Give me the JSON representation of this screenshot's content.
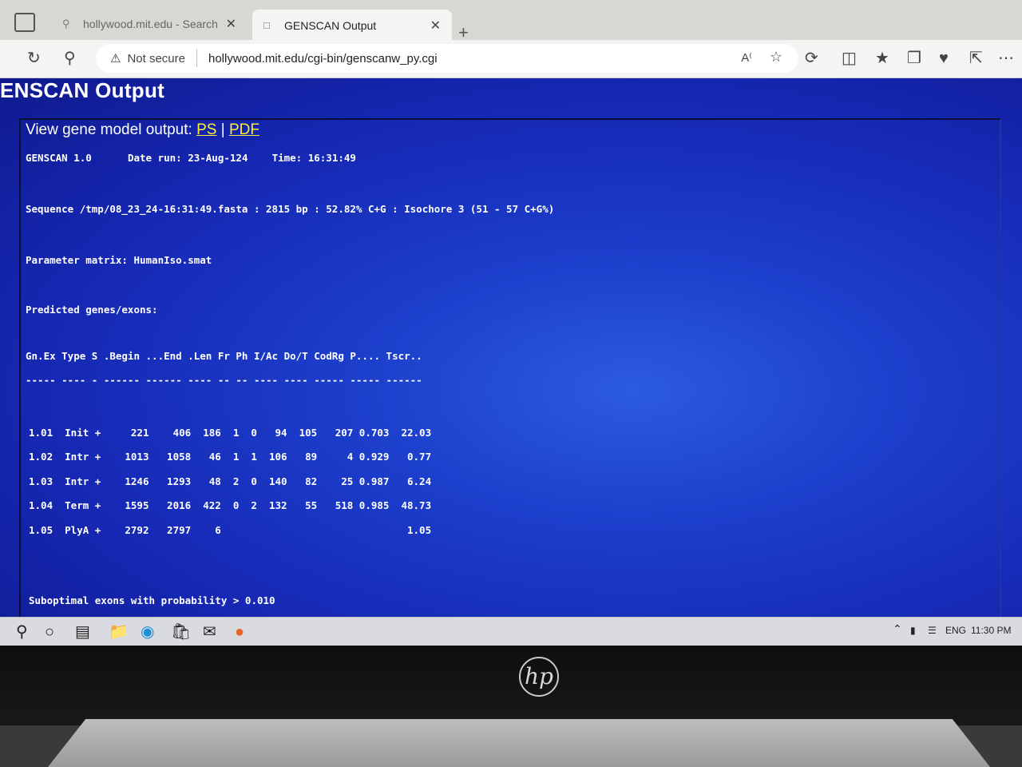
{
  "browser": {
    "tabs": [
      {
        "label": "hollywood.mit.edu - Search",
        "active": false
      },
      {
        "label": "GENSCAN Output",
        "active": true
      }
    ],
    "security_label": "Not secure",
    "url": "hollywood.mit.edu/cgi-bin/genscanw_py.cgi",
    "icons": [
      "back-arrow-icon",
      "refresh-icon",
      "search-icon",
      "read-aloud-icon",
      "favorite-star-icon",
      "extensions-icon",
      "split-screen-icon",
      "favorites-icon",
      "collections-icon",
      "performance-icon",
      "share-icon",
      "more-icon"
    ]
  },
  "page": {
    "title": "ENSCAN Output",
    "view_label": "View gene model output:",
    "link_ps": "PS",
    "link_sep": "|",
    "link_pdf": "PDF",
    "version": "GENSCAN 1.0",
    "date_run": "Date run: 23-Aug-124",
    "time_run": "Time: 16:31:49",
    "sequence_line": "Sequence /tmp/08_23_24-16:31:49.fasta : 2815 bp : 52.82% C+G : Isochore 3 (51 - 57 C+G%)",
    "parameter_line": "Parameter matrix: HumanIso.smat",
    "predicted_label": "Predicted genes/exons:",
    "table_header": "Gn.Ex Type S .Begin ...End .Len Fr Ph I/Ac Do/T CodRg P.... Tscr..",
    "table_dashes": "----- ---- - ------ ------ ---- -- -- ---- ---- ----- ----- ------",
    "exons": [
      {
        "gnex": "1.01",
        "type": "Init",
        "s": "+",
        "begin": "221",
        "end": "406",
        "len": "186",
        "fr": "1",
        "ph": "0",
        "iac": "94",
        "dot": "105",
        "codrg": "207",
        "p": "0.703",
        "tscr": "22.03"
      },
      {
        "gnex": "1.02",
        "type": "Intr",
        "s": "+",
        "begin": "1013",
        "end": "1058",
        "len": "46",
        "fr": "1",
        "ph": "1",
        "iac": "106",
        "dot": "89",
        "codrg": "4",
        "p": "0.929",
        "tscr": "0.77"
      },
      {
        "gnex": "1.03",
        "type": "Intr",
        "s": "+",
        "begin": "1246",
        "end": "1293",
        "len": "48",
        "fr": "2",
        "ph": "0",
        "iac": "140",
        "dot": "82",
        "codrg": "25",
        "p": "0.987",
        "tscr": "6.24"
      },
      {
        "gnex": "1.04",
        "type": "Term",
        "s": "+",
        "begin": "1595",
        "end": "2016",
        "len": "422",
        "fr": "0",
        "ph": "2",
        "iac": "132",
        "dot": "55",
        "codrg": "518",
        "p": "0.985",
        "tscr": "48.73"
      },
      {
        "gnex": "1.05",
        "type": "PlyA",
        "s": "+",
        "begin": "2792",
        "end": "2797",
        "len": "6",
        "fr": "",
        "ph": "",
        "iac": "",
        "dot": "",
        "codrg": "",
        "p": "",
        "tscr": "1.05"
      }
    ],
    "suboptimal_line": "Suboptimal exons with probability > 0.010"
  },
  "taskbar": {
    "lang": "ENG",
    "time": "11:30 PM"
  }
}
